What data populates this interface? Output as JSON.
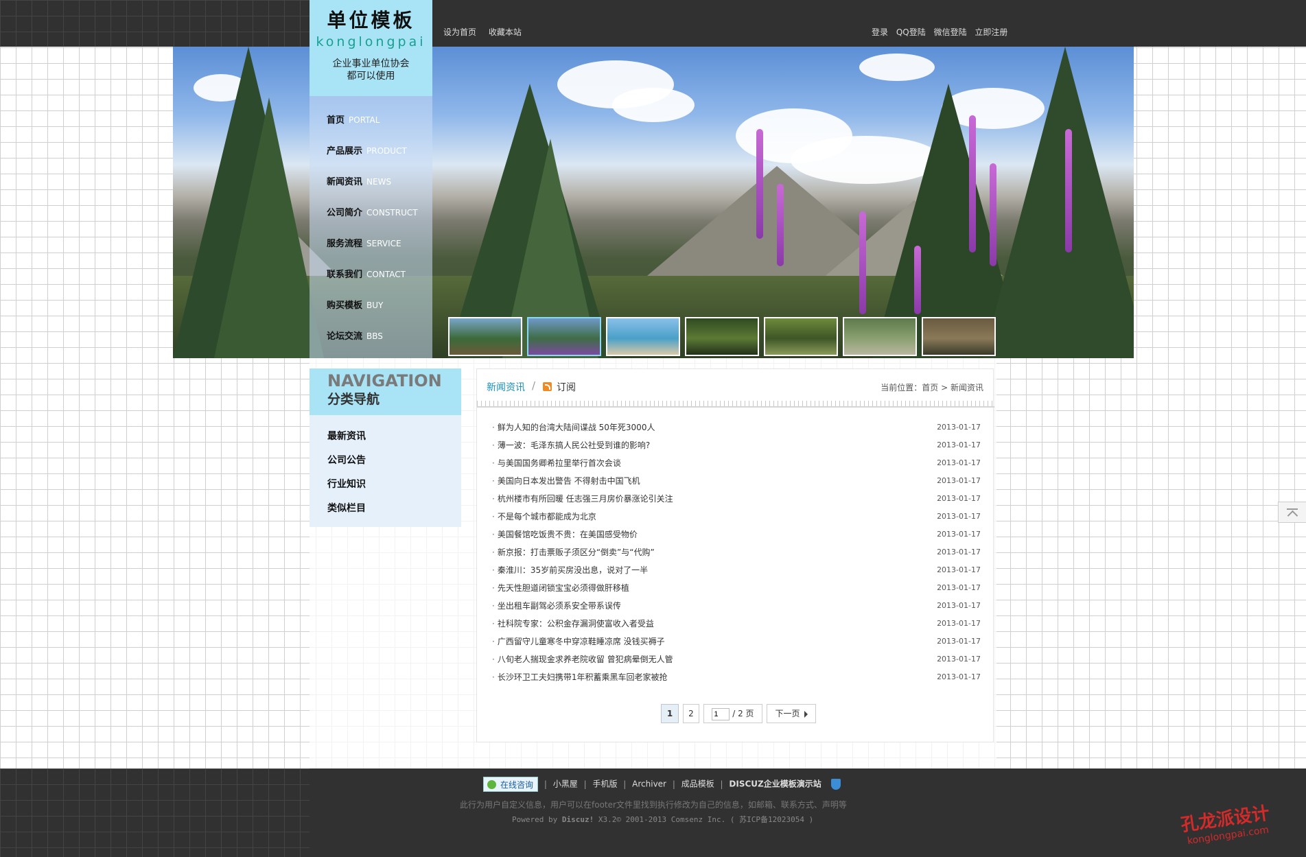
{
  "topbar": {
    "left_links": [
      "设为首页",
      "收藏本站"
    ],
    "right_links": [
      "登录",
      "QQ登陆",
      "微信登陆",
      "立即注册"
    ]
  },
  "logo": {
    "title": "单位模板",
    "subtitle": "konglongpai",
    "tagline_1": "企业事业单位协会",
    "tagline_2": "都可以使用",
    "accent_color": "#a9e4f6"
  },
  "main_nav": [
    {
      "cn": "首页",
      "en": "PORTAL"
    },
    {
      "cn": "产品展示",
      "en": "PRODUCT"
    },
    {
      "cn": "新闻资讯",
      "en": "NEWS"
    },
    {
      "cn": "公司简介",
      "en": "CONSTRUCT"
    },
    {
      "cn": "服务流程",
      "en": "SERVICE"
    },
    {
      "cn": "联系我们",
      "en": "CONTACT"
    },
    {
      "cn": "购买模板",
      "en": "BUY"
    },
    {
      "cn": "论坛交流",
      "en": "BBS"
    }
  ],
  "banner": {
    "thumb_count": 7,
    "active_thumb_index": 1
  },
  "category_nav": {
    "title_en": "NAVIGATION",
    "title_cn": "分类导航",
    "items": [
      "最新资讯",
      "公司公告",
      "行业知识",
      "类似栏目"
    ]
  },
  "content": {
    "section_title": "新闻资讯",
    "subscribe_label": "订阅",
    "location_prefix": "当前位置：",
    "breadcrumb_home": "首页",
    "breadcrumb_sep": ">",
    "breadcrumb_current": "新闻资讯",
    "news": [
      {
        "title": "鲜为人知的台湾大陆间谍战 50年死3000人",
        "date": "2013-01-17"
      },
      {
        "title": "薄一波：毛泽东搞人民公社受到谁的影响?",
        "date": "2013-01-17"
      },
      {
        "title": "与美国国务卿希拉里举行首次会谈",
        "date": "2013-01-17"
      },
      {
        "title": "美国向日本发出警告 不得射击中国飞机",
        "date": "2013-01-17"
      },
      {
        "title": "杭州楼市有所回暖 任志强三月房价暴涨论引关注",
        "date": "2013-01-17"
      },
      {
        "title": "不是每个城市都能成为北京",
        "date": "2013-01-17"
      },
      {
        "title": "美国餐馆吃饭贵不贵：在美国感受物价",
        "date": "2013-01-17"
      },
      {
        "title": "新京报：打击票贩子须区分“倒卖”与“代购”",
        "date": "2013-01-17"
      },
      {
        "title": "秦淮川：35岁前买房没出息，说对了一半",
        "date": "2013-01-17"
      },
      {
        "title": "先天性胆道闭锁宝宝必须得做肝移植",
        "date": "2013-01-17"
      },
      {
        "title": "坐出租车副驾必须系安全带系误传",
        "date": "2013-01-17"
      },
      {
        "title": "社科院专家：公积金存漏洞使富收入者受益",
        "date": "2013-01-17"
      },
      {
        "title": "广西留守儿童寒冬中穿凉鞋睡凉席 没钱买褥子",
        "date": "2013-01-17"
      },
      {
        "title": "八旬老人揣现金求养老院收留 曾犯病晕倒无人管",
        "date": "2013-01-17"
      },
      {
        "title": "长沙环卫工夫妇携带1年积蓄乘黑车回老家被抢",
        "date": "2013-01-17"
      }
    ],
    "pager": {
      "current": "1",
      "page2": "2",
      "input_value": "1",
      "total_label": "/ 2 页",
      "next_label": "下一页"
    }
  },
  "footer": {
    "online_label": "在线咨询",
    "links": [
      "小黑屋",
      "手机版",
      "Archiver",
      "成品模板",
      "DISCUZ企业模板演示站"
    ],
    "sep": "|",
    "custom_info": "此行为用户自定义信息，用户可以在footer文件里找到执行修改为自己的信息，如邮箱、联系方式、声明等",
    "powered_prefix": "Powered by",
    "powered_brand": "Discuz!",
    "powered_rest": "X3.2© 2001-2013 Comsenz Inc.",
    "icp": "( 苏ICP备12023054 )"
  },
  "watermark": {
    "text": "孔龙派设计",
    "url": "konglongpai.com"
  },
  "icons": [
    "rss-icon",
    "qq-online-icon",
    "security-shield-icon",
    "back-to-top-icon",
    "next-arrow-icon"
  ]
}
